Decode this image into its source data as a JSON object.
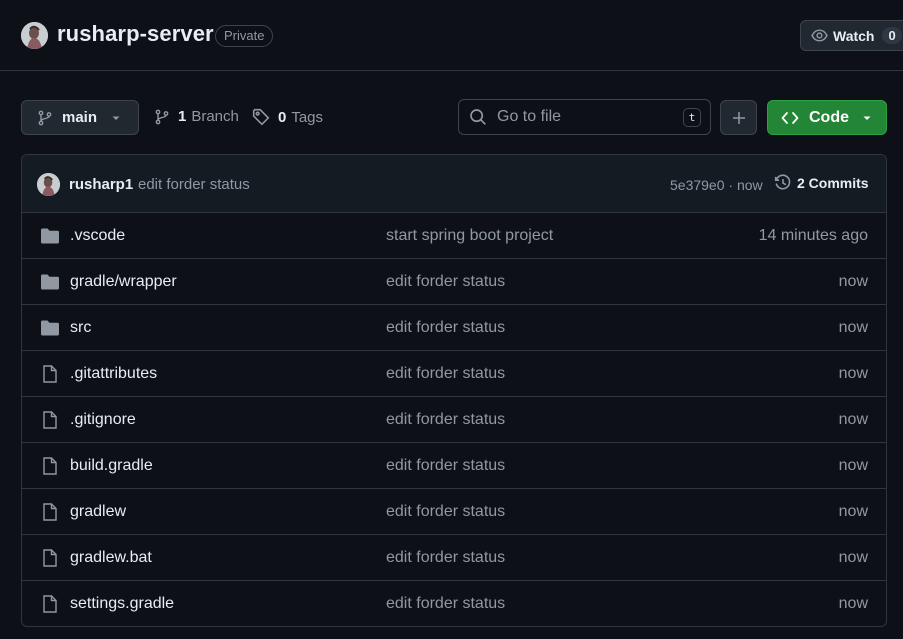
{
  "repo": {
    "name": "rusharp-server",
    "visibility": "Private",
    "watch_label": "Watch",
    "watch_count": "0"
  },
  "toolbar": {
    "branch": "main",
    "branch_count": "1",
    "branch_label": "Branch",
    "tag_count": "0",
    "tag_label": "Tags",
    "goto_placeholder": "Go to file",
    "goto_shortcut": "t",
    "code_label": "Code"
  },
  "latest_commit": {
    "author": "rusharp1",
    "message": "edit forder status",
    "hash_time": "5e379e0 · now",
    "commits_label": "2 Commits"
  },
  "files": [
    {
      "name": ".vscode",
      "type": "folder",
      "message": "start spring boot project",
      "date": "14 minutes ago"
    },
    {
      "name": "gradle/wrapper",
      "type": "folder",
      "message": "edit forder status",
      "date": "now"
    },
    {
      "name": "src",
      "type": "folder",
      "message": "edit forder status",
      "date": "now"
    },
    {
      "name": ".gitattributes",
      "type": "file",
      "message": "edit forder status",
      "date": "now"
    },
    {
      "name": ".gitignore",
      "type": "file",
      "message": "edit forder status",
      "date": "now"
    },
    {
      "name": "build.gradle",
      "type": "file",
      "message": "edit forder status",
      "date": "now"
    },
    {
      "name": "gradlew",
      "type": "file",
      "message": "edit forder status",
      "date": "now"
    },
    {
      "name": "gradlew.bat",
      "type": "file",
      "message": "edit forder status",
      "date": "now"
    },
    {
      "name": "settings.gradle",
      "type": "file",
      "message": "edit forder status",
      "date": "now"
    }
  ],
  "colors": {
    "background": "#0d1117",
    "border": "#30363d",
    "code_button": "#238636",
    "muted_text": "#9198a1",
    "icon": "#9198a1"
  }
}
